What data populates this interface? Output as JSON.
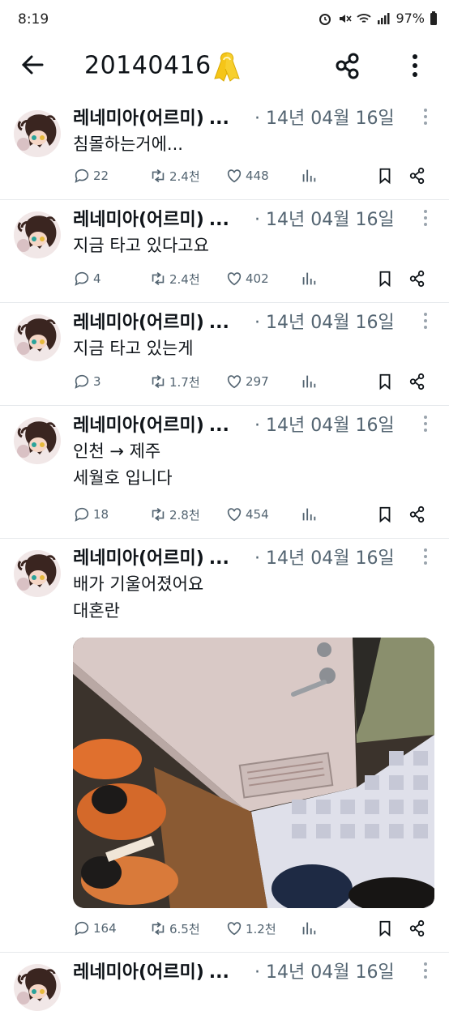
{
  "status": {
    "time": "8:19",
    "battery": "97%"
  },
  "header": {
    "title": "20140416"
  },
  "tweets": [
    {
      "name": "레네미아(어르미)",
      "ellipsis": "...",
      "date": "· 14년 04월 16일",
      "text": "침몰하는거에...",
      "replies": "22",
      "retweets": "2.4천",
      "likes": "448"
    },
    {
      "name": "레네미아(어르미)",
      "ellipsis": "...",
      "date": "· 14년 04월 16일",
      "text": "지금 타고 있다고요",
      "replies": "4",
      "retweets": "2.4천",
      "likes": "402"
    },
    {
      "name": "레네미아(어르미)",
      "ellipsis": "...",
      "date": "· 14년 04월 16일",
      "text": "지금 타고 있는게",
      "replies": "3",
      "retweets": "1.7천",
      "likes": "297"
    },
    {
      "name": "레네미아(어르미)",
      "ellipsis": "...",
      "date": "· 14년 04월 16일",
      "text": "인천 → 제주\n세월호 입니다",
      "replies": "18",
      "retweets": "2.8천",
      "likes": "454"
    },
    {
      "name": "레네미아(어르미)",
      "ellipsis": "...",
      "date": "· 14년 04월 16일",
      "text": "배가 기울어졌어요\n대혼란",
      "replies": "164",
      "retweets": "6.5천",
      "likes": "1.2천"
    },
    {
      "name": "레네미아(어르미)",
      "ellipsis": "...",
      "date": "· 14년 04월 16일",
      "text": "",
      "replies": "",
      "retweets": "",
      "likes": ""
    }
  ],
  "colors": {
    "text": "#0f1419",
    "secondary": "#536471",
    "divider": "#e6e9ec",
    "ribbon": "#f5c518"
  }
}
